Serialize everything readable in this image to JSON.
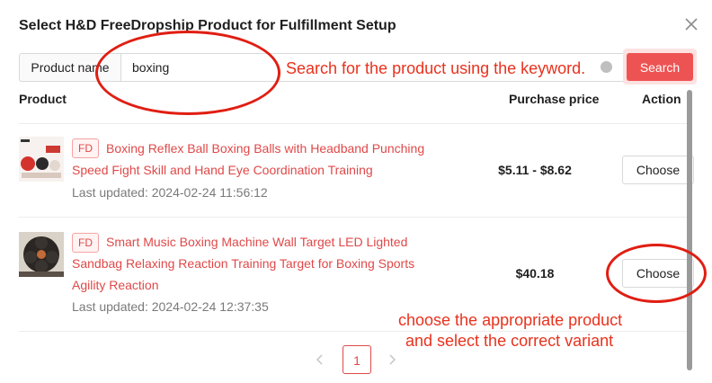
{
  "modal": {
    "title": "Select H&D FreeDropship Product for Fulfillment Setup"
  },
  "search": {
    "addon_label": "Product name",
    "value": "boxing",
    "button_label": "Search"
  },
  "table": {
    "headers": {
      "product": "Product",
      "price": "Purchase price",
      "action": "Action"
    },
    "rows": [
      {
        "tag": "FD",
        "name": "Boxing Reflex Ball Boxing Balls with Headband Punching Speed Fight Skill and Hand Eye Coordination Training",
        "updated": "Last updated: 2024-02-24 11:56:12",
        "price": "$5.11 - $8.62",
        "action_label": "Choose"
      },
      {
        "tag": "FD",
        "name": "Smart Music Boxing Machine Wall Target LED Lighted Sandbag Relaxing Reaction Training Target for Boxing Sports Agility Reaction",
        "updated": "Last updated: 2024-02-24 12:37:35",
        "price": "$40.18",
        "action_label": "Choose"
      }
    ]
  },
  "pagination": {
    "current_page": "1",
    "prev_icon": "chevron-left-icon",
    "next_icon": "chevron-right-icon"
  },
  "annotations": {
    "search_hint": "Search for the product using the keyword.",
    "choose_hint_line1": "choose the appropriate product",
    "choose_hint_line2": "and select the correct variant",
    "color": "#e8321e"
  },
  "colors": {
    "accent": "#ee5353",
    "link": "#e04848"
  }
}
